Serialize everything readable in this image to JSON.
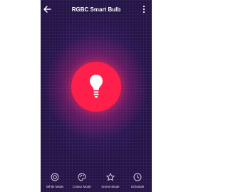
{
  "header": {
    "title": "RGBC Smart Bulb",
    "back_icon": "arrow-left-icon",
    "menu_icon": "more-vertical-icon"
  },
  "power": {
    "icon": "lightbulb-icon",
    "color": "#ff1f4b"
  },
  "bottom_nav": {
    "items": [
      {
        "label": "White Mode",
        "icon": "sun-icon"
      },
      {
        "label": "Colour Mode",
        "icon": "palette-icon"
      },
      {
        "label": "Scene Mode",
        "icon": "star-icon"
      },
      {
        "label": "Schedule",
        "icon": "clock-icon"
      }
    ]
  },
  "colors": {
    "background": "#2c1652",
    "accent": "#ff1f4b",
    "text": "#ffffff"
  }
}
